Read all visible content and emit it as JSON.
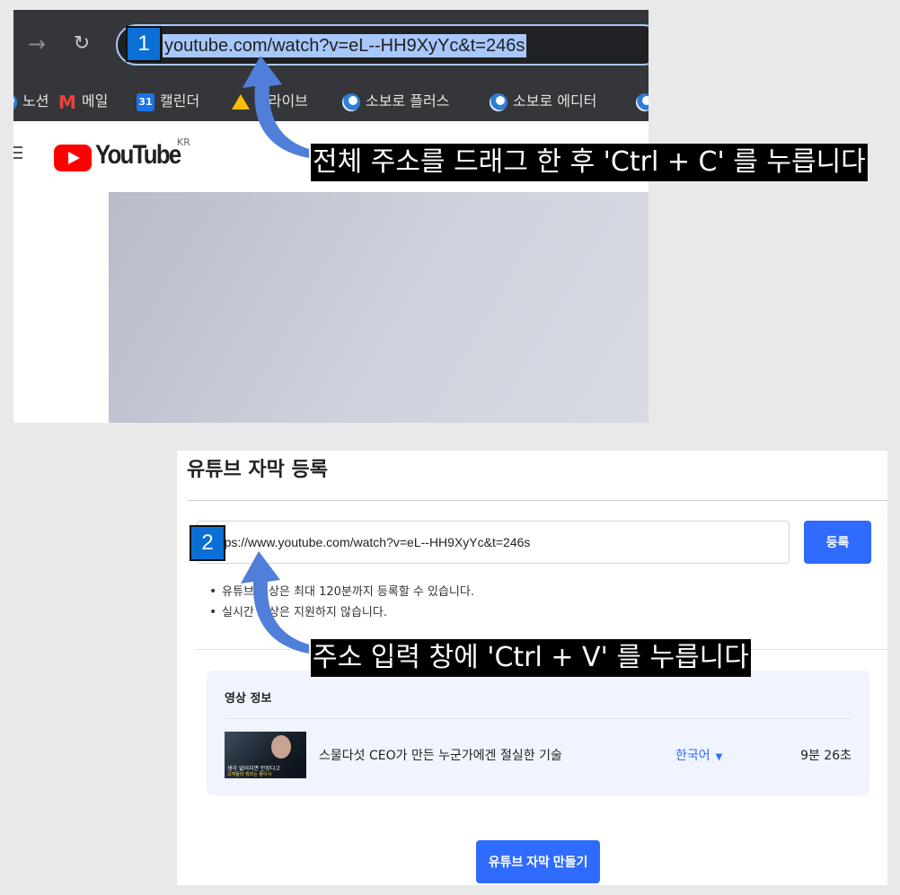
{
  "browser": {
    "url_selected": "youtube.com/watch?v=eL--HH9XyYc&t=246s",
    "bookmarks": [
      {
        "icon": "globe-icon",
        "label": "노션"
      },
      {
        "icon": "gmail-icon",
        "label": "메일"
      },
      {
        "icon": "calendar-icon",
        "label": "캘린더",
        "icon_text": "31"
      },
      {
        "icon": "drive-icon",
        "label": "드라이브"
      },
      {
        "icon": "globe-icon",
        "label": "소보로 플러스"
      },
      {
        "icon": "globe-icon",
        "label": "소보로 에디터"
      }
    ]
  },
  "youtube": {
    "wordmark": "YouTube",
    "region": "KR"
  },
  "registration": {
    "title": "유튜브 자막 등록",
    "url_value": "https://www.youtube.com/watch?v=eL--HH9XyYc&t=246s",
    "register_label": "등록",
    "notes": [
      "유튜브 영상은 최대 120분까지 등록할 수 있습니다.",
      "실시간 영상은 지원하지 않습니다."
    ],
    "video_info": {
      "title": "영상 정보",
      "thumbnail_caption_1": "생각 없어지면 안된다고",
      "thumbnail_caption_2": "고객들이 뭐라는 줄이서",
      "name": "스물다섯 CEO가 만든 누군가에겐 절실한 기술",
      "language": "한국어",
      "duration": "9분 26초"
    },
    "make_label": "유튜브 자막 만들기"
  },
  "annotations": {
    "step1_number": "1",
    "step1_text": "전체 주소를 드래그 한 후 'Ctrl + C' 를 누릅니다",
    "step2_number": "2",
    "step2_text": "주소 입력 창에 'Ctrl + V' 를 누릅니다",
    "badge_color": "#0b6fd6",
    "arrow_color": "#4f7fd8"
  }
}
